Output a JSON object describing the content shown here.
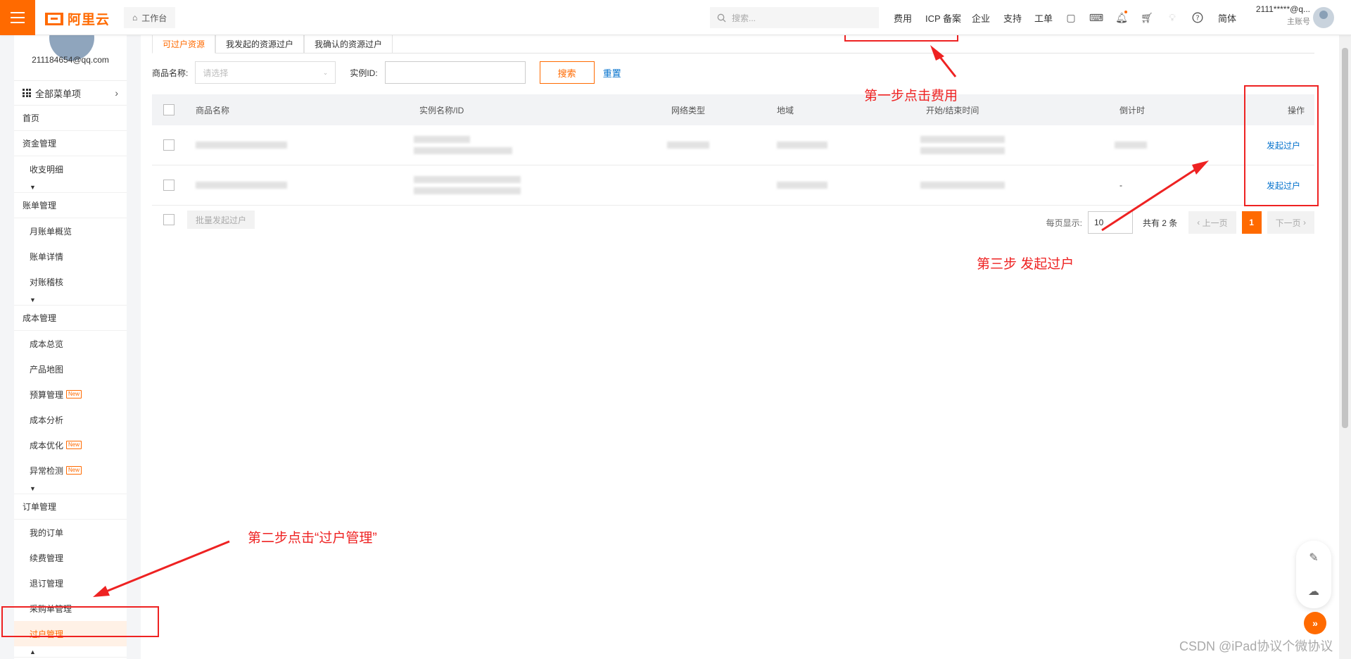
{
  "header": {
    "logo_text": "阿里云",
    "workspace": "工作台",
    "search_placeholder": "搜索...",
    "nav": [
      "费用",
      "ICP 备案",
      "企业",
      "支持",
      "工单"
    ],
    "lang": "简体",
    "user_name": "2111*****@q...",
    "user_role": "主账号"
  },
  "sidebar": {
    "email": "211184654@qq.com",
    "all_menu": "全部菜单项",
    "items": [
      {
        "label": "首页",
        "type": "grp"
      },
      {
        "label": "资金管理",
        "type": "grp"
      },
      {
        "label": "收支明细",
        "type": "sub"
      },
      {
        "label": "账单管理",
        "type": "grp"
      },
      {
        "label": "月账单概览",
        "type": "sub"
      },
      {
        "label": "账单详情",
        "type": "sub"
      },
      {
        "label": "对账稽核",
        "type": "sub"
      },
      {
        "label": "成本管理",
        "type": "grp"
      },
      {
        "label": "成本总览",
        "type": "sub"
      },
      {
        "label": "产品地图",
        "type": "sub"
      },
      {
        "label": "预算管理",
        "type": "sub",
        "badge": "New"
      },
      {
        "label": "成本分析",
        "type": "sub"
      },
      {
        "label": "成本优化",
        "type": "sub",
        "badge": "New"
      },
      {
        "label": "异常检测",
        "type": "sub",
        "badge": "New"
      },
      {
        "label": "订单管理",
        "type": "grp"
      },
      {
        "label": "我的订单",
        "type": "sub"
      },
      {
        "label": "续费管理",
        "type": "sub"
      },
      {
        "label": "退订管理",
        "type": "sub"
      },
      {
        "label": "采购单管理",
        "type": "sub"
      },
      {
        "label": "过户管理",
        "type": "sub",
        "active": true
      }
    ]
  },
  "main": {
    "tabs": [
      "可过户资源",
      "我发起的资源过户",
      "我确认的资源过户"
    ],
    "filter": {
      "product_label": "商品名称:",
      "product_placeholder": "请选择",
      "instance_label": "实例ID:",
      "search_button": "搜索",
      "reset_link": "重置"
    },
    "table": {
      "columns": [
        "商品名称",
        "实例名称/ID",
        "网络类型",
        "地域",
        "开始/结束时间",
        "倒计时",
        "操作"
      ],
      "rows": [
        {
          "countdown": "",
          "action": "发起过户"
        },
        {
          "countdown": "-",
          "action": "发起过户"
        }
      ]
    },
    "footer": {
      "batch_button": "批量发起过户",
      "page_size_label": "每页显示:",
      "page_size": "10",
      "total": "共有 2 条",
      "prev": "上一页",
      "current_page": "1",
      "next": "下一页"
    }
  },
  "annotations": {
    "step1": "第一步点击费用",
    "step2": "第二步点击“过户管理”",
    "step3": "第三步 发起过户",
    "color": "#ee2222"
  },
  "watermark": "CSDN @iPad协议个微协议",
  "colors": {
    "accent": "#ff6a00",
    "link": "#0070cc"
  }
}
